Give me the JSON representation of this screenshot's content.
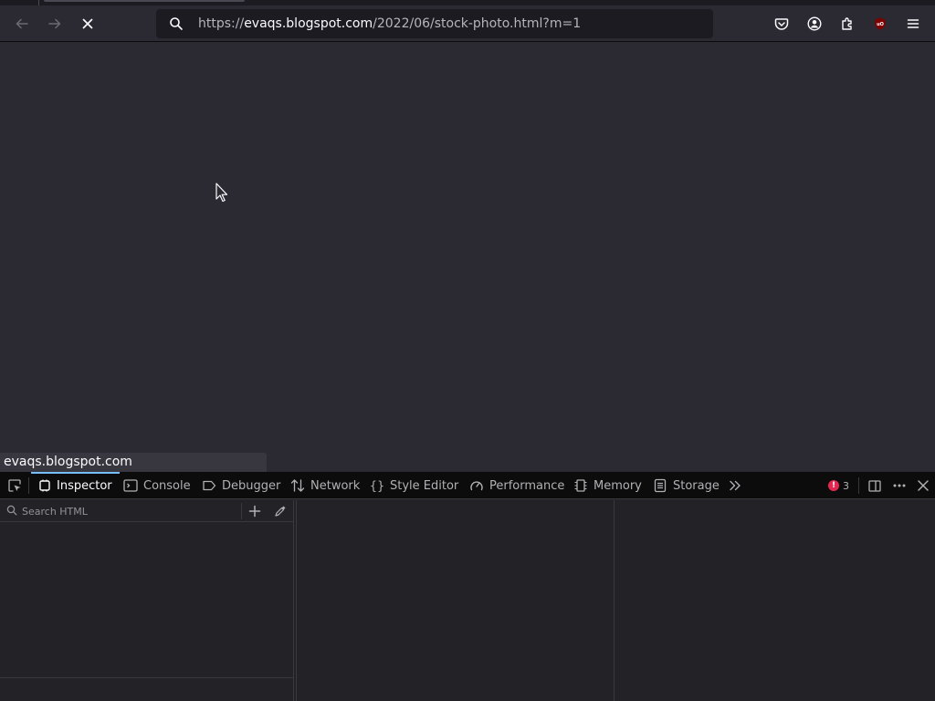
{
  "browser": {
    "url": {
      "scheme": "https://",
      "host": "evaqs.blogspot.com",
      "path": "/2022/06/stock-photo.html?m=1"
    },
    "nav": {
      "back_icon": "arrow-left-icon",
      "forward_icon": "arrow-right-icon",
      "stop_icon": "close-icon"
    },
    "toolbar_icons": [
      "pocket-icon",
      "account-icon",
      "extensions-icon",
      "ublock-icon",
      "menu-icon"
    ]
  },
  "content": {
    "status_url": "evaqs.blogspot.com"
  },
  "devtools": {
    "tabs": [
      {
        "label": "Inspector",
        "icon": "inspector-icon",
        "active": true
      },
      {
        "label": "Console",
        "icon": "console-icon"
      },
      {
        "label": "Debugger",
        "icon": "debugger-icon"
      },
      {
        "label": "Network",
        "icon": "network-icon"
      },
      {
        "label": "Style Editor",
        "icon": "style-editor-icon"
      },
      {
        "label": "Performance",
        "icon": "performance-icon"
      },
      {
        "label": "Memory",
        "icon": "memory-icon"
      },
      {
        "label": "Storage",
        "icon": "storage-icon"
      }
    ],
    "error_count": "3",
    "search_placeholder": "Search HTML",
    "colors": {
      "accent": "#75bfff",
      "error": "#e22850"
    }
  }
}
